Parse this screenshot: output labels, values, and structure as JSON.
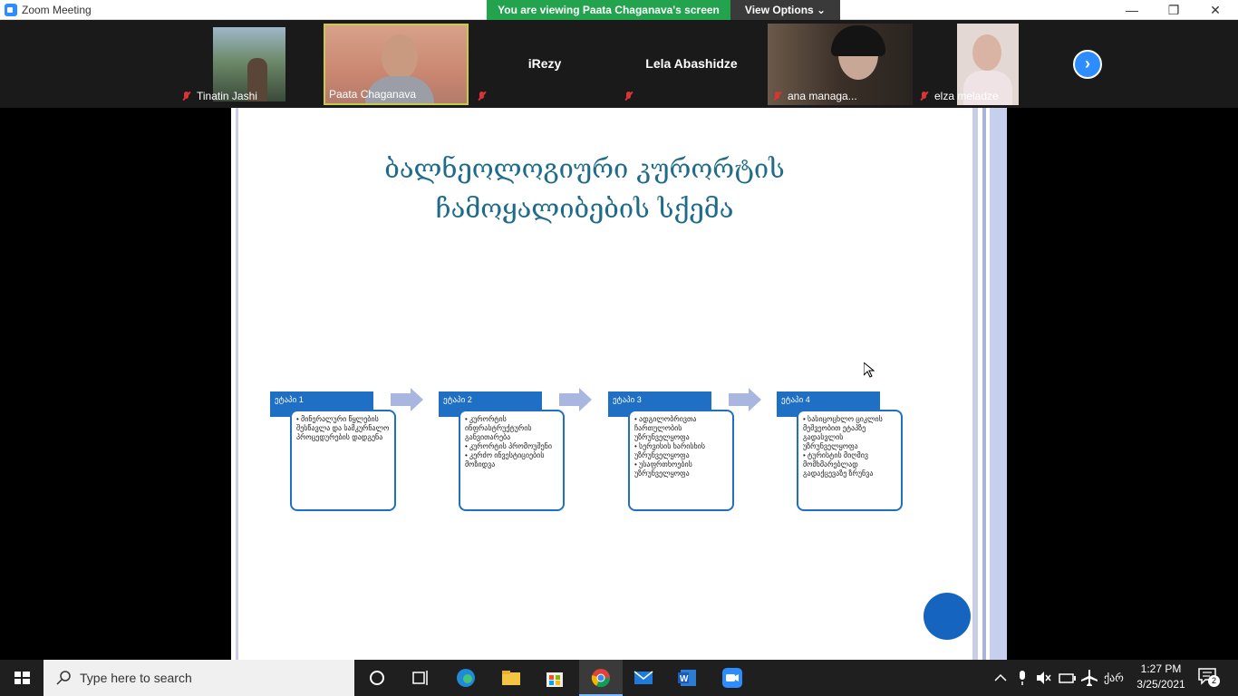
{
  "window": {
    "title": "Zoom Meeting",
    "minimize": "—",
    "restore": "❐",
    "close": "✕"
  },
  "share_banner": {
    "text": "You are viewing Paata Chaganava's screen",
    "view_options": "View Options ⌄"
  },
  "gallery": {
    "participants": [
      {
        "name": "Tinatin Jashi",
        "muted": true,
        "video": true
      },
      {
        "name": "Paata Chaganava",
        "muted": false,
        "video": true,
        "active": true
      },
      {
        "name": "iRezy",
        "muted": true,
        "video": false
      },
      {
        "name": "Lela Abashidze",
        "muted": true,
        "video": false
      },
      {
        "name": "ana managa...",
        "muted": true,
        "video": true
      },
      {
        "name": "elza meladze",
        "muted": true,
        "video": true
      }
    ],
    "next_icon": "›"
  },
  "slide": {
    "title_line1": "ბალნეოლოგიური კურორტის",
    "title_line2": "ჩამოყალიბების სქემა",
    "stages": [
      {
        "label": "ეტაპი 1",
        "bullets": [
          "• მინერალური წყლების შესწავლა და სამკურნალო პროცედურების დადგენა"
        ]
      },
      {
        "label": "ეტაპი 2",
        "bullets": [
          "• კურორტის ინფრასტრუქტურის განვითარება",
          "• კურორტის პრომოუშენი",
          "• კერძო ინვესტიციების მოზიდვა"
        ]
      },
      {
        "label": "ეტაპი 3",
        "bullets": [
          "• ადგილობრივთა ჩართულობის უზრუნველყოფა",
          "• სერვისის ხარისხის უზრუნველყოფა",
          "• უსაფრთხოების უზრუნველყოფა"
        ]
      },
      {
        "label": "ეტაპი 4",
        "bullets": [
          "• სასიცოცხლო ციკლის მეშვეობით ეტაპზე გადასვლის უზრუნველყოფა",
          "• ტურისტის მიღმივ მომხმარებლად გადაქცევაზე ზრუნვა"
        ]
      }
    ]
  },
  "taskbar": {
    "search_placeholder": "Type here to search",
    "time": "1:27 PM",
    "date": "3/25/2021",
    "language": "ქარ",
    "notifications": "2"
  },
  "colors": {
    "zoom_blue": "#2d8cff",
    "banner_green": "#23a34e",
    "slide_blue": "#1f6fc5",
    "title_teal": "#1f6b8a"
  }
}
